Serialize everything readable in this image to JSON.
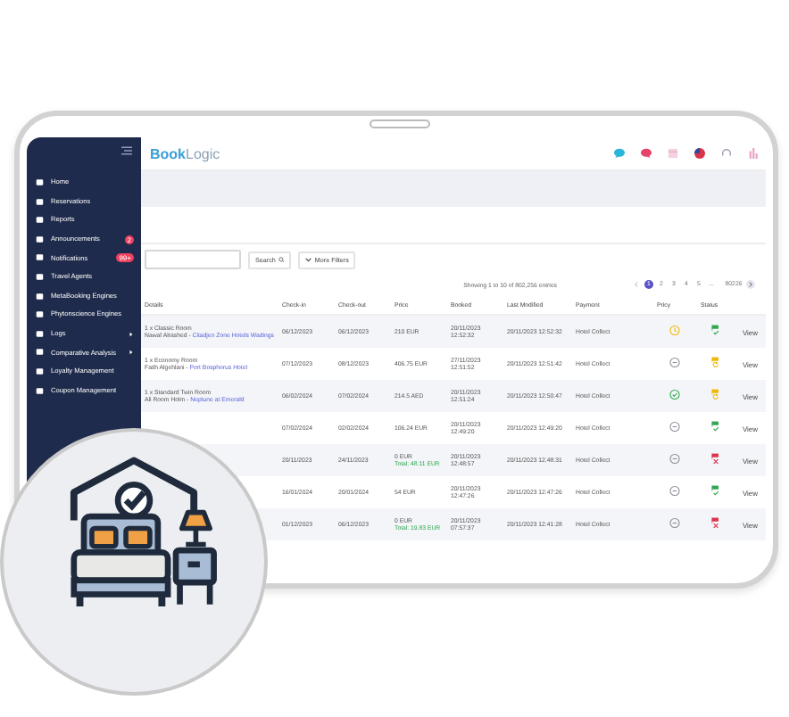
{
  "brand": {
    "part_one": "Book",
    "part_two": "Logic"
  },
  "sidebar": {
    "items": [
      {
        "label": "Home",
        "has_submenu": false
      },
      {
        "label": "Reservations",
        "has_submenu": false
      },
      {
        "label": "Reports",
        "has_submenu": false
      },
      {
        "label": "Announcements",
        "has_submenu": false,
        "badge": "2"
      },
      {
        "label": "Notifications",
        "has_submenu": false,
        "badge": "99+"
      },
      {
        "label": "Travel Agents",
        "has_submenu": false
      },
      {
        "label": "MetaBooking Engines",
        "has_submenu": false
      },
      {
        "label": "Phytonscience Engines",
        "has_submenu": false
      },
      {
        "label": "Logs",
        "has_submenu": true
      },
      {
        "label": "Comparative Analysis",
        "has_submenu": true
      },
      {
        "label": "Loyalty Management",
        "has_submenu": false
      },
      {
        "label": "Coupon Management",
        "has_submenu": false
      }
    ]
  },
  "filters": {
    "search_button": "Search",
    "more_filters": "More Filters"
  },
  "summary": "Showing 1 to 10 of 802,256 entries",
  "pagination": {
    "pages": [
      {
        "label": "1",
        "selected": true
      },
      {
        "label": "2",
        "selected": false
      },
      {
        "label": "3",
        "selected": false
      },
      {
        "label": "4",
        "selected": false
      },
      {
        "label": "5",
        "selected": false
      }
    ],
    "ellipsis": "...",
    "last": "80226"
  },
  "table": {
    "columns": [
      "Details",
      "Check-in",
      "Check-out",
      "Price",
      "Booked",
      "Last Modified",
      "Payment",
      "Pricy",
      "Status"
    ],
    "rows": [
      {
        "room": "1 x Classic Room",
        "guest": "Nawaf Alrashed - ",
        "hotel": "Citadjen Zone Hotels Wadings",
        "check_in": "06/12/2023",
        "check_out": "06/12/2023",
        "price": "210 EUR",
        "booked": [
          "20/11/2023",
          "12:52:32"
        ],
        "modified": "20/11/2023 12:52:32",
        "payment": "Hotel Collect",
        "pricy": {
          "kind": "clock"
        },
        "status": {
          "kind": "confirmed"
        },
        "action": "View"
      },
      {
        "room": "1 x Economy Room",
        "guest": "Fatih Algehlani - ",
        "hotel": "Port Bosphorus Hotel",
        "check_in": "07/12/2023",
        "check_out": "08/12/2023",
        "price": "406.75 EUR",
        "booked": [
          "27/11/2023",
          "12:51:52"
        ],
        "modified": "20/11/2023 12:51:42",
        "payment": "Hotel Collect",
        "pricy": {
          "kind": "none"
        },
        "status": {
          "kind": "modified"
        },
        "action": "View"
      },
      {
        "room": "1 x Standard Twin Room",
        "guest": "Ali Room Holm - ",
        "hotel": "Neptune at Emerald",
        "check_in": "06/02/2024",
        "check_out": "07/02/2024",
        "price": "214.5 AED",
        "booked": [
          "20/11/2023",
          "12:51:24"
        ],
        "modified": "20/11/2023 12:50:47",
        "payment": "Hotel Collect",
        "pricy": {
          "kind": "check"
        },
        "status": {
          "kind": "modified"
        },
        "action": "View"
      },
      {
        "check_in": "07/02/2024",
        "check_out": "02/02/2024",
        "price": "106.24 EUR",
        "booked": [
          "20/11/2023",
          "12:49:20"
        ],
        "modified": "20/11/2023 12:49:20",
        "payment": "Hotel Collect",
        "pricy": {
          "kind": "none"
        },
        "status": {
          "kind": "confirmed"
        },
        "action": "View"
      },
      {
        "check_in": "20/11/2023",
        "check_out": "24/11/2023",
        "price": "0 EUR",
        "total": "Total: 48.11 EUR",
        "booked": [
          "20/11/2023",
          "12:48:57"
        ],
        "modified": "20/11/2023 12:48:31",
        "payment": "Hotel Collect",
        "pricy": {
          "kind": "none"
        },
        "status": {
          "kind": "cancelled"
        },
        "action": "View"
      },
      {
        "check_in": "16/01/2024",
        "check_out": "20/01/2024",
        "price": "54 EUR",
        "booked": [
          "20/11/2023",
          "12:47:26"
        ],
        "modified": "20/11/2023 12:47:26",
        "payment": "Hotel Collect",
        "pricy": {
          "kind": "none"
        },
        "status": {
          "kind": "confirmed"
        },
        "action": "View"
      },
      {
        "check_in": "01/12/2023",
        "check_out": "06/12/2023",
        "price": "0 EUR",
        "total": "Total: 19.83 EUR",
        "booked": [
          "20/11/2023",
          "07:57:37"
        ],
        "modified": "20/11/2023 12:41:28",
        "payment": "Hotel Collect",
        "pricy": {
          "kind": "none"
        },
        "status": {
          "kind": "cancelled"
        },
        "action": "View"
      }
    ]
  }
}
